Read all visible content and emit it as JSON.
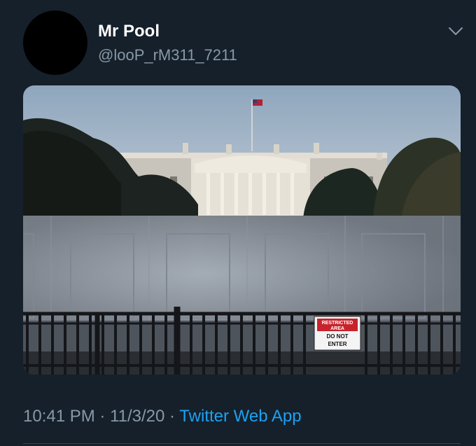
{
  "tweet": {
    "display_name": "Mr Pool",
    "handle": "@looP_rM311_7211",
    "time": "10:41 PM",
    "date": "11/3/20",
    "separator": "·",
    "source": "Twitter Web App"
  },
  "media": {
    "sign_line1": "RESTRICTED",
    "sign_line2": "AREA",
    "sign_line3": "DO NOT",
    "sign_line4": "ENTER"
  },
  "icons": {
    "menu": "chevron-down-icon"
  },
  "colors": {
    "background": "#15202b",
    "secondary_text": "#8899a6",
    "link": "#1da1f2",
    "sign_red": "#c8232c"
  }
}
